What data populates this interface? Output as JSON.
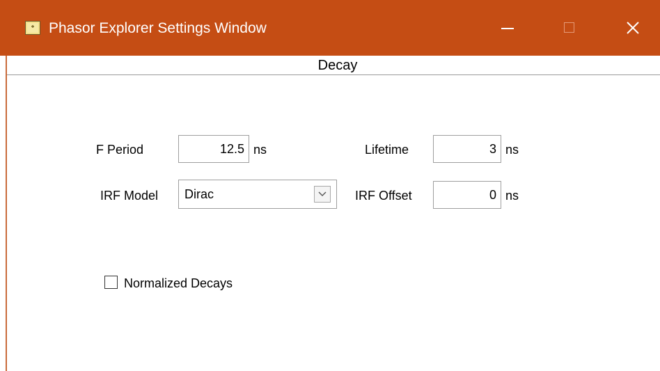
{
  "window": {
    "title": "Phasor Explorer Settings Window",
    "icon": "labview-vi-icon",
    "controls": [
      "minimize-icon",
      "maximize-icon",
      "close-icon"
    ],
    "titlebar_color": "#c54d14"
  },
  "tab": {
    "label": "Decay"
  },
  "fields": {
    "f_period": {
      "label": "F Period",
      "value": "12.5",
      "unit": "ns"
    },
    "lifetime": {
      "label": "Lifetime",
      "value": "3",
      "unit": "ns"
    },
    "irf_model": {
      "label": "IRF Model",
      "value": "Dirac"
    },
    "irf_offset": {
      "label": "IRF Offset",
      "value": "0",
      "unit": "ns"
    }
  },
  "normalized_decays": {
    "label": "Normalized Decays",
    "checked": false
  }
}
